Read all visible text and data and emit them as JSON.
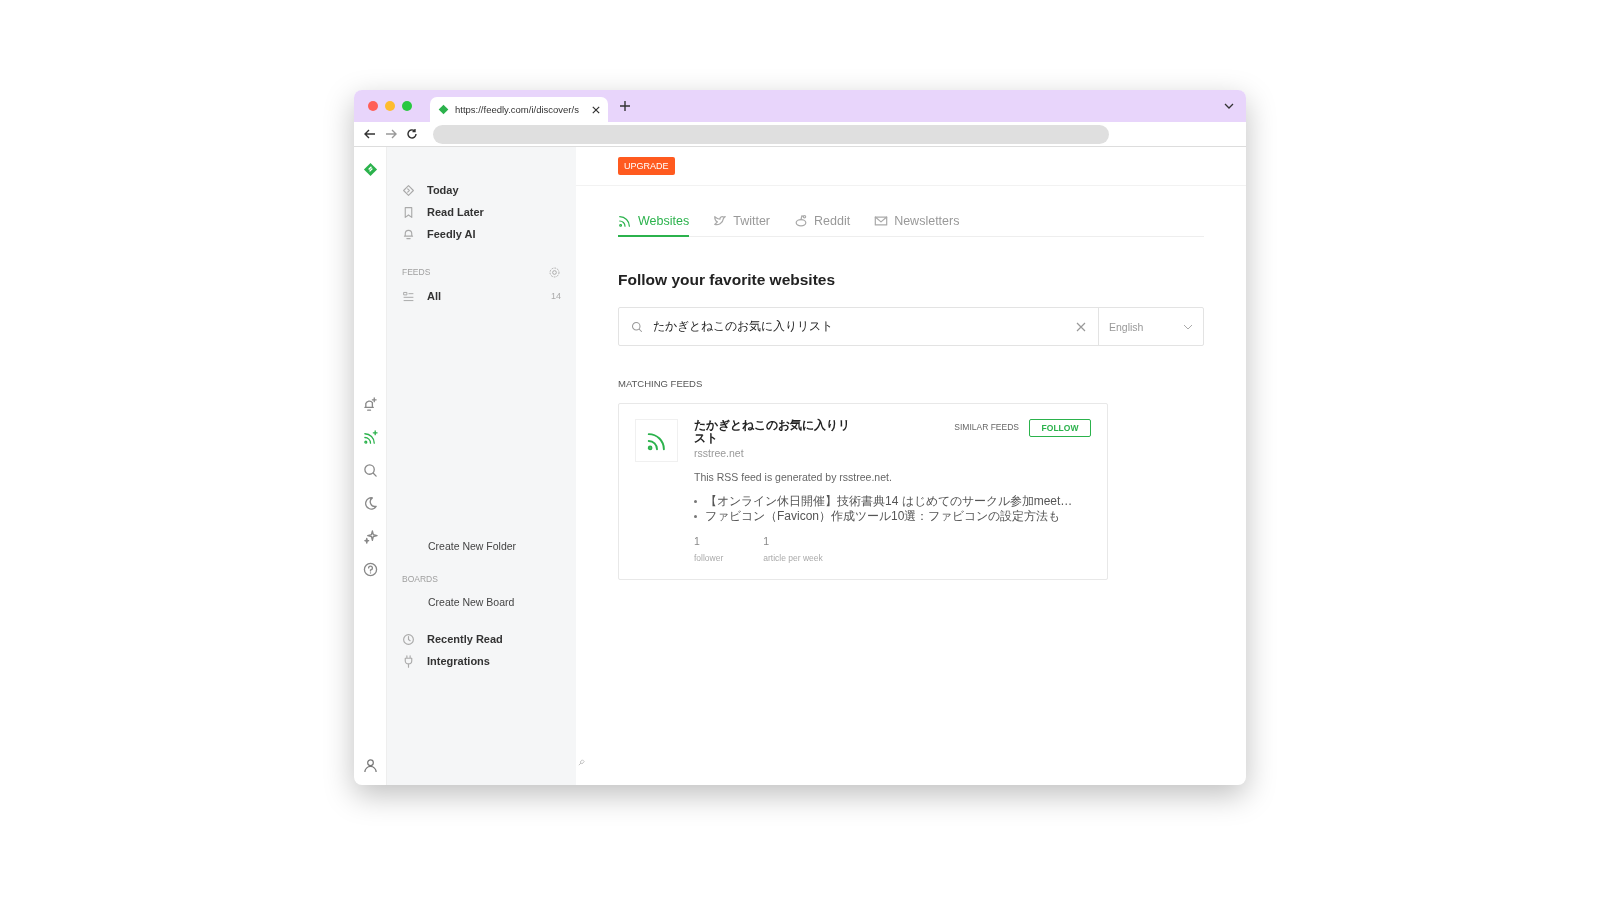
{
  "browser": {
    "tab_title": "https://feedly.com/i/discover/s"
  },
  "rail": [
    {
      "kind": "bell-plus",
      "selected": false
    },
    {
      "kind": "rss-plus",
      "selected": true
    },
    {
      "kind": "search",
      "selected": false
    },
    {
      "kind": "moon",
      "selected": false
    },
    {
      "kind": "sparkle",
      "selected": false
    },
    {
      "kind": "help",
      "selected": false
    }
  ],
  "sidebar": {
    "nav": [
      {
        "kind": "today",
        "label": "Today"
      },
      {
        "kind": "bookmark",
        "label": "Read Later"
      },
      {
        "kind": "ai",
        "label": "Feedly AI"
      }
    ],
    "feeds_heading": "FEEDS",
    "feeds": [
      {
        "label": "All",
        "count": "14"
      }
    ],
    "create_folder": "Create New Folder",
    "boards_heading": "BOARDS",
    "create_board": "Create New Board",
    "bottom": [
      {
        "kind": "clock",
        "label": "Recently Read"
      },
      {
        "kind": "plug",
        "label": "Integrations"
      }
    ]
  },
  "upgrade": "UPGRADE",
  "tabs": [
    {
      "kind": "rss",
      "label": "Websites",
      "selected": true
    },
    {
      "kind": "bird",
      "label": "Twitter",
      "selected": false
    },
    {
      "kind": "reddit",
      "label": "Reddit",
      "selected": false
    },
    {
      "kind": "mail",
      "label": "Newsletters",
      "selected": false
    }
  ],
  "heading": "Follow your favorite websites",
  "search": {
    "value": "たかぎとねこのお気に入りリスト",
    "language": "English"
  },
  "matching_heading": "MATCHING FEEDS",
  "feeds_found": [
    {
      "title": "たかぎとねこのお気に入りリスト",
      "source": "rsstree.net",
      "similar": "SIMILAR FEEDS",
      "follow": "FOLLOW",
      "description": "This RSS feed is generated by rsstree.net.",
      "articles": [
        "【オンライン休日開催】技術書典14 はじめてのサークル参加meet…",
        "ファビコン（Favicon）作成ツール10選：ファビコンの設定方法も"
      ],
      "stats": [
        {
          "value": "1",
          "label": "follower"
        },
        {
          "value": "1",
          "label": "article per week"
        }
      ]
    }
  ]
}
